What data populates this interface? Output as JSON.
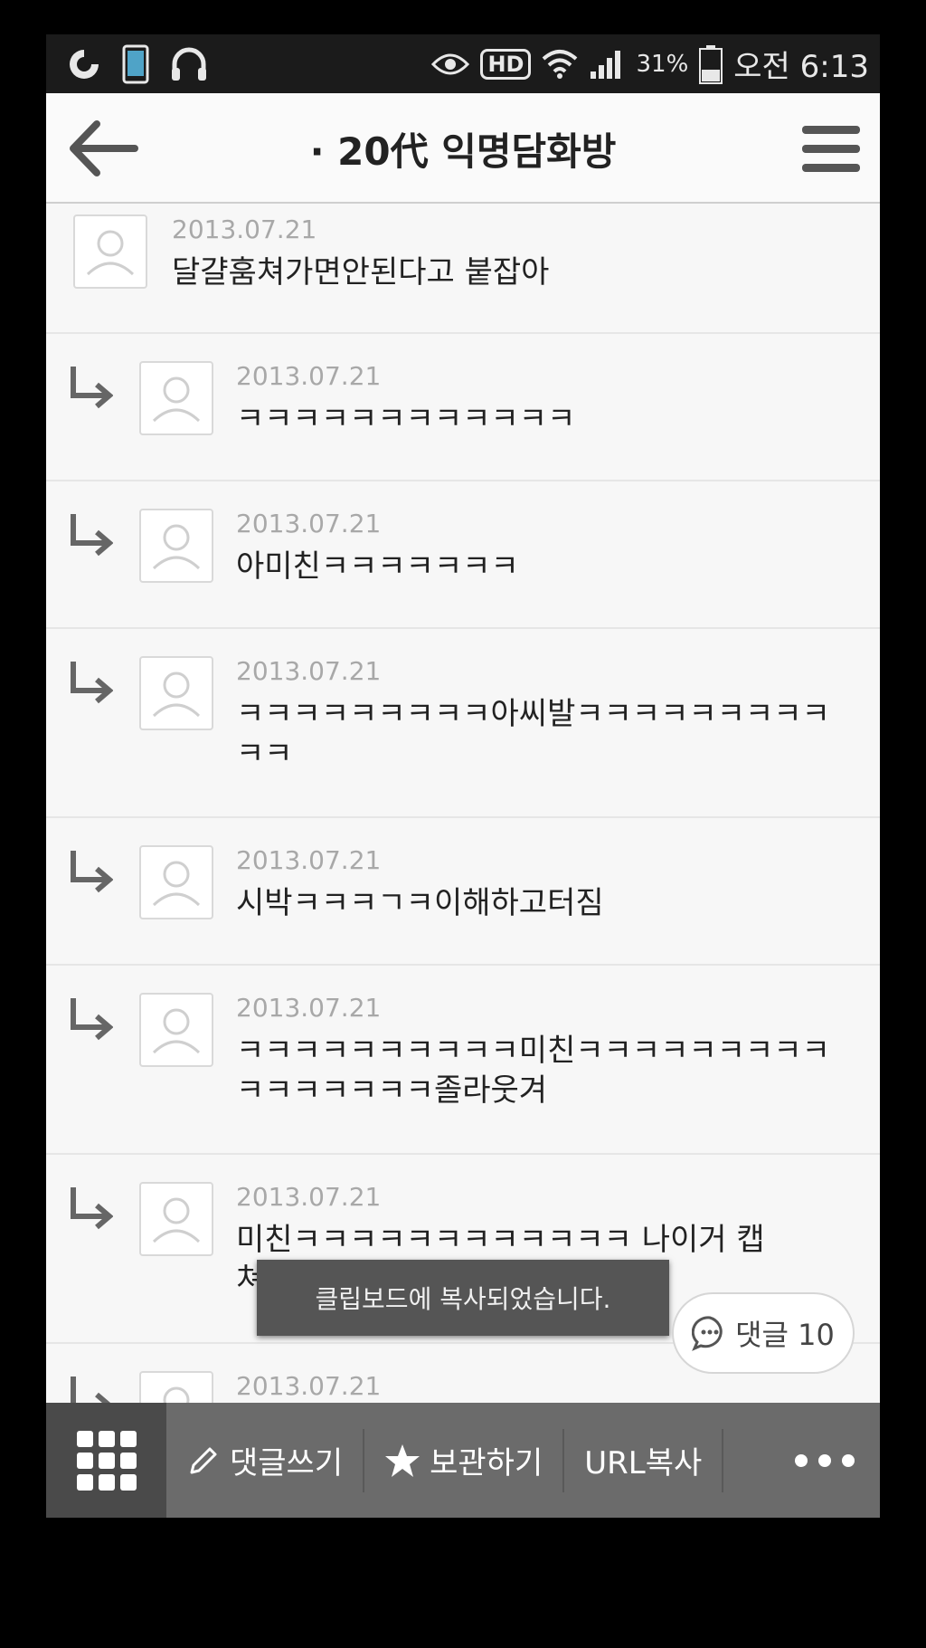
{
  "status_bar": {
    "battery": "31%",
    "clock": "오전 6:13",
    "hd_label": "HD",
    "icons": [
      "sync-icon",
      "phone-icon",
      "headphones-icon",
      "eye-icon",
      "hd-icon",
      "wifi-icon",
      "signal-icon",
      "battery-icon"
    ]
  },
  "header": {
    "title": "· 20代 익명담화방"
  },
  "comments": [
    {
      "date": "2013.07.21",
      "text": "달걀훔쳐가면안된다고 붙잡아",
      "reply": false
    },
    {
      "date": "2013.07.21",
      "text": "ㅋㅋㅋㅋㅋㅋㅋㅋㅋㅋㅋㅋ",
      "reply": true
    },
    {
      "date": "2013.07.21",
      "text": "아미친ㅋㅋㅋㅋㅋㅋㅋ",
      "reply": true
    },
    {
      "date": "2013.07.21",
      "text": "ㅋㅋㅋㅋㅋㅋㅋㅋㅋ아씨발ㅋㅋㅋㅋㅋㅋㅋㅋㅋㅋㅋ",
      "reply": true
    },
    {
      "date": "2013.07.21",
      "text": "시박ㅋㅋㅋㄱㅋ이해하고터짐",
      "reply": true
    },
    {
      "date": "2013.07.21",
      "text": "ㅋㅋㅋㅋㅋㅋㅋㅋㅋㅋ미친ㅋㅋㅋㅋㅋㅋㅋㅋㅋㅋㅋㅋㅋㅋㅋㅋ졸라웃겨",
      "reply": true
    },
    {
      "date": "2013.07.21",
      "text": "미친ㅋㅋㅋㅋㅋㅋㅋㅋㅋㅋㅋㅋ 나이거 캡쳐해가도돼?",
      "reply": true
    },
    {
      "date": "2013.07.21",
      "text": "",
      "reply": true
    }
  ],
  "toast": "클립보드에 복사되었습니다.",
  "comment_count": {
    "label": "댓글 10"
  },
  "bottom_bar": {
    "write": "댓글쓰기",
    "save": "보관하기",
    "copy_url": "URL복사"
  }
}
